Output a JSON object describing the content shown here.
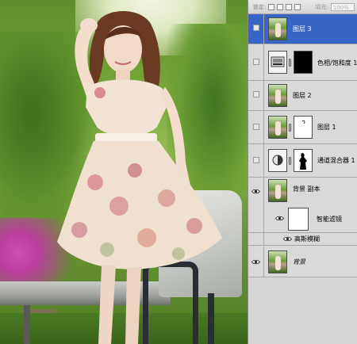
{
  "panel": {
    "lock_label": "锁定:",
    "fill_label": "填充:",
    "fill_value": "100%"
  },
  "layers": [
    {
      "name": "图层 3",
      "selected": true,
      "visible": false
    },
    {
      "name": "色相/饱和度 1",
      "selected": false,
      "visible": false
    },
    {
      "name": "图层 2",
      "selected": false,
      "visible": false
    },
    {
      "name": "图层 1",
      "selected": false,
      "visible": false
    },
    {
      "name": "通道混合器 1",
      "selected": false,
      "visible": false
    },
    {
      "name": "背景 副本",
      "selected": false,
      "visible": true
    },
    {
      "name": "背景",
      "selected": false,
      "visible": true
    }
  ],
  "smart_filters": {
    "label": "智能滤镜",
    "filter": "高斯模糊"
  },
  "colors": {
    "selected_row": "#3766c6",
    "panel_bg": "#d6d6d6"
  }
}
